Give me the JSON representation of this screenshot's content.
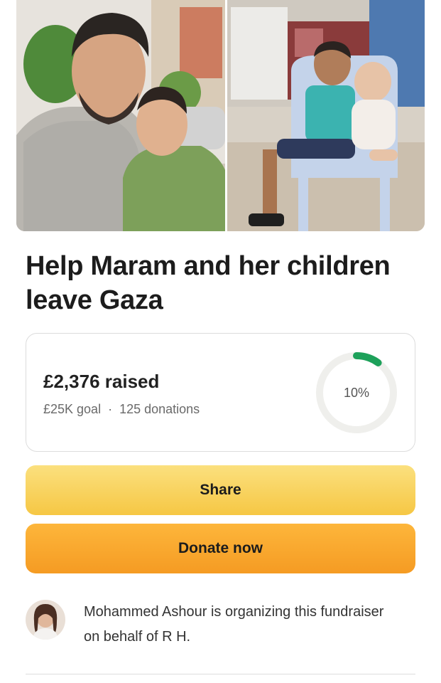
{
  "campaign": {
    "title": "Help Maram and her children leave Gaza"
  },
  "stats": {
    "raised_amount": "£2,376",
    "raised_word": "raised",
    "goal": "£25K goal",
    "separator": "·",
    "donations": "125 donations",
    "progress_label": "10%",
    "progress_fraction": 0.1,
    "progress_color": "#1da15a"
  },
  "actions": {
    "share_label": "Share",
    "donate_label": "Donate now"
  },
  "organizer": {
    "text": "Mohammed Ashour is organizing this fundraiser on behalf of R H."
  },
  "colors": {
    "share_bg": "#f6c744",
    "donate_bg": "#f59b23"
  }
}
